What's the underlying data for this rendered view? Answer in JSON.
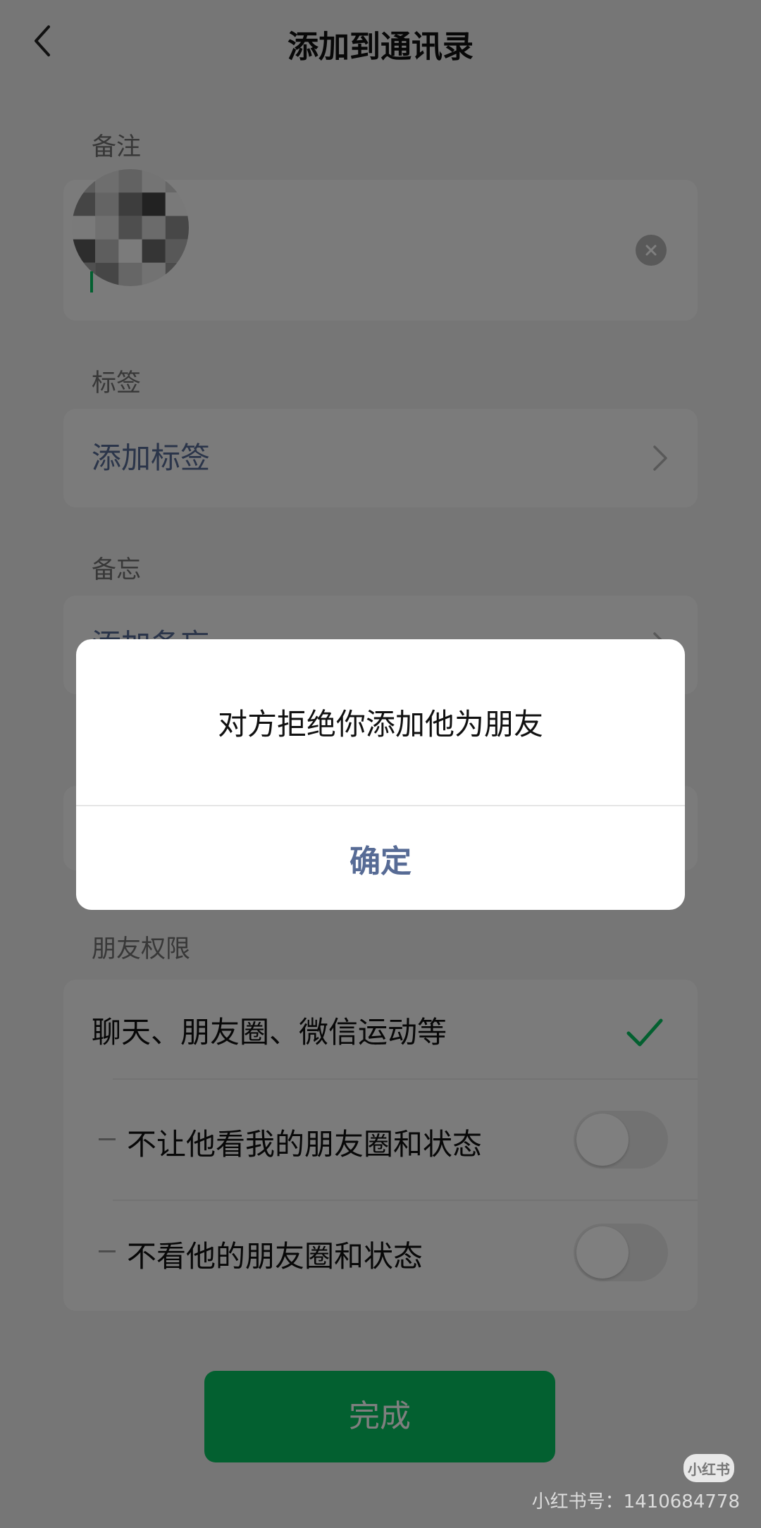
{
  "header": {
    "title": "添加到通讯录"
  },
  "remark": {
    "label": "备注"
  },
  "tags": {
    "label": "标签",
    "action": "添加标签"
  },
  "memo": {
    "label": "备忘",
    "action": "添加备忘"
  },
  "permissions": {
    "label": "朋友权限",
    "chat_option": "聊天、朋友圈、微信运动等",
    "option_hide_my_moments": "不让他看我的朋友圈和状态",
    "option_hide_their_moments": "不看他的朋友圈和状态"
  },
  "done_button": "完成",
  "dialog": {
    "message": "对方拒绝你添加他为朋友",
    "confirm": "确定"
  },
  "watermark": {
    "logo": "小红书",
    "id_text": "小红书号：1410684778"
  },
  "colors": {
    "accent": "#07c160",
    "link": "#576b95"
  }
}
